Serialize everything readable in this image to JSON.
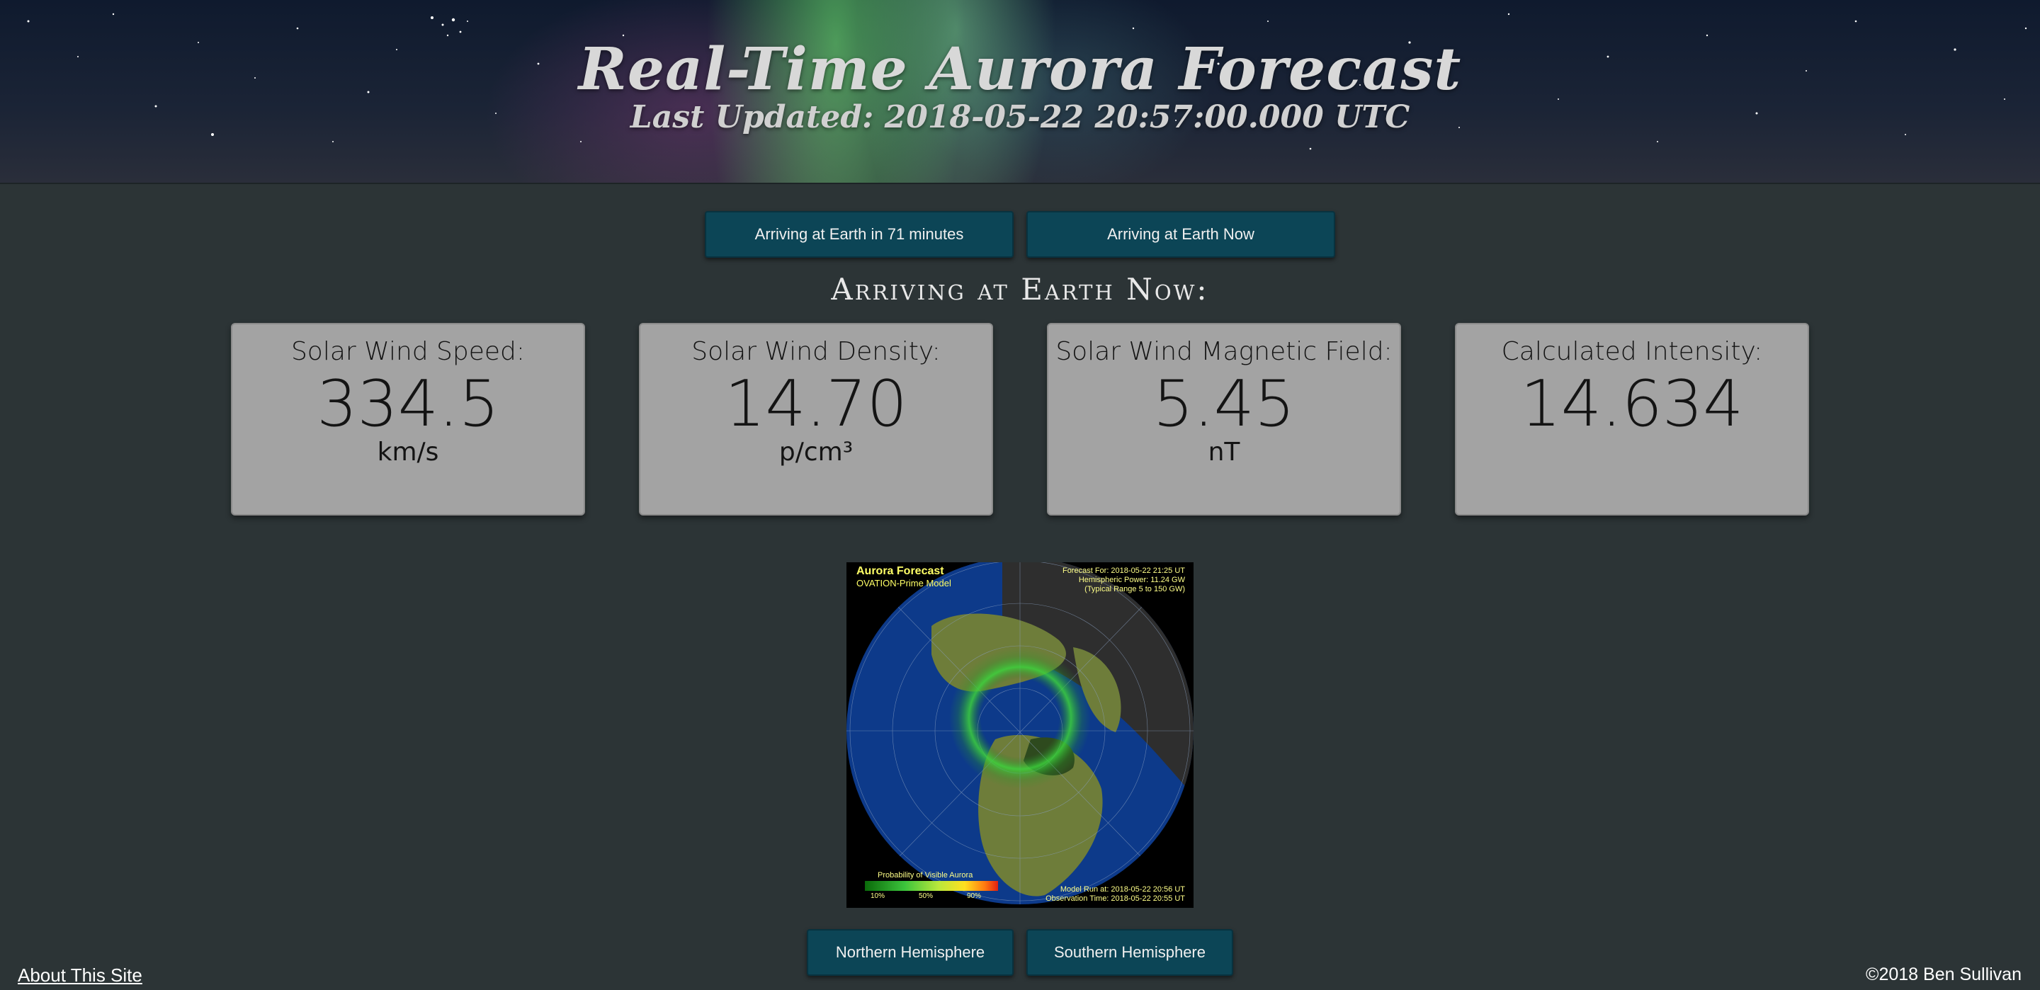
{
  "header": {
    "title": "Real-Time Aurora Forecast",
    "last_updated": "Last Updated: 2018-05-22 20:57:00.000 UTC"
  },
  "timing_buttons": {
    "later_label": "Arriving at Earth in 71 minutes",
    "now_label": "Arriving at Earth Now"
  },
  "section_heading": "Arriving at Earth Now:",
  "cards": [
    {
      "label": "Solar Wind Speed:",
      "value": "334.5",
      "unit": "km/s"
    },
    {
      "label": "Solar Wind Density:",
      "value": "14.70",
      "unit": "p/cm³"
    },
    {
      "label": "Solar Wind Magnetic Field:",
      "value": "5.45",
      "unit": "nT"
    },
    {
      "label": "Calculated Intensity:",
      "value": "14.634",
      "unit": ""
    }
  ],
  "map": {
    "title": "Aurora Forecast",
    "model": "OVATION-Prime Model",
    "forecast_for": "Forecast For: 2018-05-22 21:25 UT",
    "hemispheric_power": "Hemispheric Power: 11.24 GW",
    "typical_range": "(Typical Range 5 to 150 GW)",
    "probability_label": "Probability of Visible Aurora",
    "ticks": [
      "10%",
      "50%",
      "90%"
    ],
    "model_run": "Model Run at: 2018-05-22 20:56 UT",
    "observation_time": "Observation Time: 2018-05-22 20:55 UT"
  },
  "hemisphere_buttons": {
    "north_label": "Northern Hemisphere",
    "south_label": "Southern Hemisphere"
  },
  "footer": {
    "about_link": "About This Site",
    "copyright": "©2018 Ben Sullivan"
  },
  "colors": {
    "page_bg": "#2c3436",
    "button_bg": "#0c4556",
    "card_bg": "#a3a3a3"
  }
}
